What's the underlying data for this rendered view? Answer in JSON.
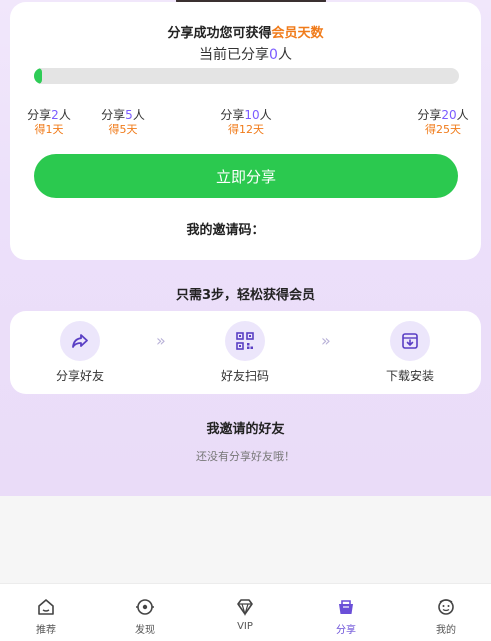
{
  "progress_card": {
    "headline_prefix": "分享成功您可获得",
    "headline_accent": "会员天数",
    "current_prefix": "当前已分享",
    "current_count": "0",
    "current_suffix": "人",
    "progress_fraction": 0.0,
    "milestones": [
      {
        "prefix": "分享",
        "num": "2",
        "suffix": "人",
        "reward": "得1天"
      },
      {
        "prefix": "分享",
        "num": "5",
        "suffix": "人",
        "reward": "得5天"
      },
      {
        "prefix": "分享",
        "num": "10",
        "suffix": "人",
        "reward": "得12天"
      },
      {
        "prefix": "分享",
        "num": "20",
        "suffix": "人",
        "reward": "得25天"
      }
    ],
    "share_button_label": "立即分享",
    "invite_code_label": "我的邀请码："
  },
  "steps": {
    "title": "只需3步，轻松获得会员",
    "items": [
      {
        "label": "分享好友",
        "icon": "share-arrow-icon"
      },
      {
        "label": "好友扫码",
        "icon": "qr-code-icon"
      },
      {
        "label": "下载安装",
        "icon": "download-box-icon"
      }
    ],
    "separator": "»"
  },
  "friends": {
    "title": "我邀请的好友",
    "empty_text": "还没有分享好友哦！"
  },
  "tabbar": {
    "items": [
      {
        "label": "推荐",
        "icon": "home-icon"
      },
      {
        "label": "发现",
        "icon": "discover-icon"
      },
      {
        "label": "VIP",
        "icon": "diamond-icon"
      },
      {
        "label": "分享",
        "icon": "share-basket-icon"
      },
      {
        "label": "我的",
        "icon": "profile-icon"
      }
    ],
    "active_index": 3
  },
  "colors": {
    "accent_orange": "#f07b1a",
    "accent_purple": "#7b5cff",
    "button_green": "#2bc94f",
    "progress_green": "#2ecc56",
    "background_purple": "#efe4fa"
  }
}
